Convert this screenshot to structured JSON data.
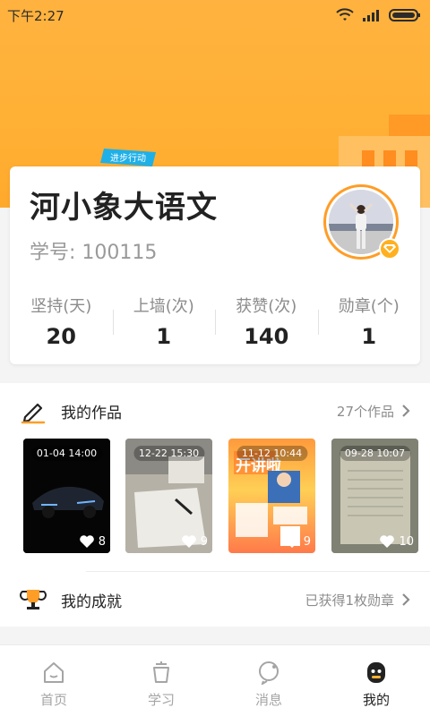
{
  "status_bar": {
    "time": "下午2:27"
  },
  "header": {
    "flag_text": "进步行动"
  },
  "profile": {
    "name": "河小象大语文",
    "student_id": "学号: 100115",
    "stats": [
      {
        "label": "坚持(天)",
        "value": "20"
      },
      {
        "label": "上墙(次)",
        "value": "1"
      },
      {
        "label": "获赞(次)",
        "value": "140"
      },
      {
        "label": "勋章(个)",
        "value": "1"
      }
    ]
  },
  "works": {
    "title": "我的作品",
    "count_text": "27个作品",
    "items": [
      {
        "date": "01-04 14:00",
        "likes": "8"
      },
      {
        "date": "12-22 15:30",
        "likes": "9"
      },
      {
        "date": "11-12 10:44",
        "likes": "9"
      },
      {
        "date": "09-28 10:07",
        "likes": "10"
      }
    ],
    "poster_text": "开讲啦"
  },
  "achievements": {
    "title": "我的成就",
    "summary": "已获得1枚勋章"
  },
  "bottom_nav": {
    "items": [
      {
        "label": "首页",
        "icon": "home-icon"
      },
      {
        "label": "学习",
        "icon": "cup-icon"
      },
      {
        "label": "消息",
        "icon": "message-icon"
      },
      {
        "label": "我的",
        "icon": "robot-face-icon"
      }
    ],
    "active_index": 3
  },
  "colors": {
    "accent": "#ffb135",
    "active_tab": "#222222",
    "inactive_tab": "#a5a5a5"
  }
}
